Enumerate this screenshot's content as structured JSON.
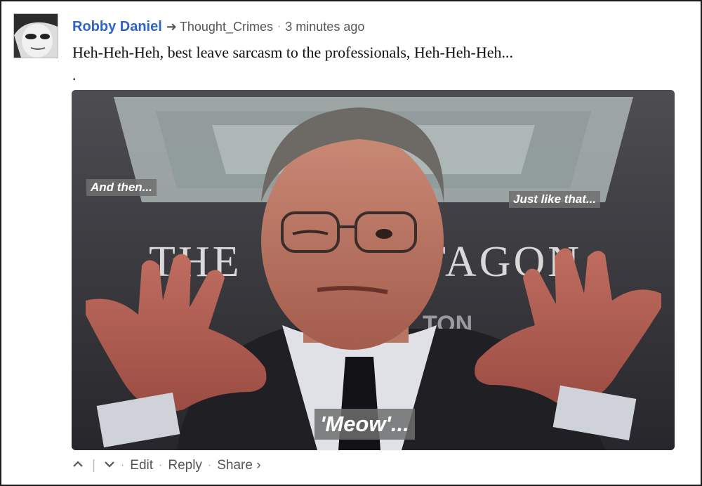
{
  "comment": {
    "author": "Robby Daniel",
    "reply_arrow_icon": "reply-arrow-icon",
    "reply_to": "Thought_Crimes",
    "separator": "·",
    "timestamp": "3 minutes ago",
    "text": "Heh-Heh-Heh, best leave sarcasm to the professionals, Heh-Heh-Heh...",
    "trailing_period": "."
  },
  "media": {
    "background_sign": "THE PENTAGON",
    "captions": {
      "top_left": "And then...",
      "top_right": "Just like that...",
      "bottom": "'Meow'..."
    }
  },
  "actions": {
    "upvote_icon": "chevron-up-icon",
    "downvote_icon": "chevron-down-icon",
    "divider": "|",
    "dot": "·",
    "edit": "Edit",
    "reply": "Reply",
    "share": "Share ›"
  },
  "colors": {
    "author_link": "#2f64c5",
    "meta_text": "#555555",
    "frame_border": "#1b1b1b"
  }
}
